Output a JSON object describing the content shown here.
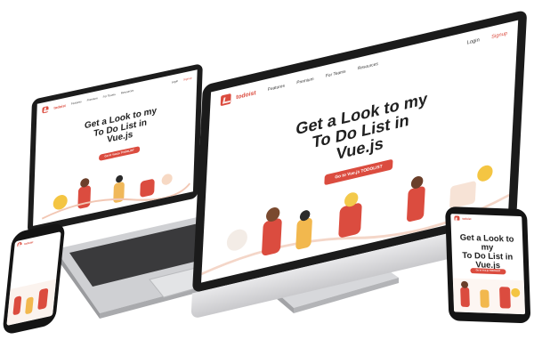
{
  "app": {
    "brand": "todoist",
    "nav_links": [
      "Features",
      "Premium",
      "For Teams",
      "Resources"
    ],
    "login": "Login",
    "signup": "Signup",
    "hero_lines": [
      "Get a Look to my",
      "To Do List in",
      "Vue.js"
    ],
    "cta": "Go to Vue.js TODOLIST"
  },
  "colors": {
    "accent": "#db4c3f",
    "bezel": "#1b1b1b",
    "aluminum": "#c9c9cc"
  },
  "devices": [
    "desktop-monitor",
    "laptop",
    "smartphone",
    "tablet"
  ]
}
